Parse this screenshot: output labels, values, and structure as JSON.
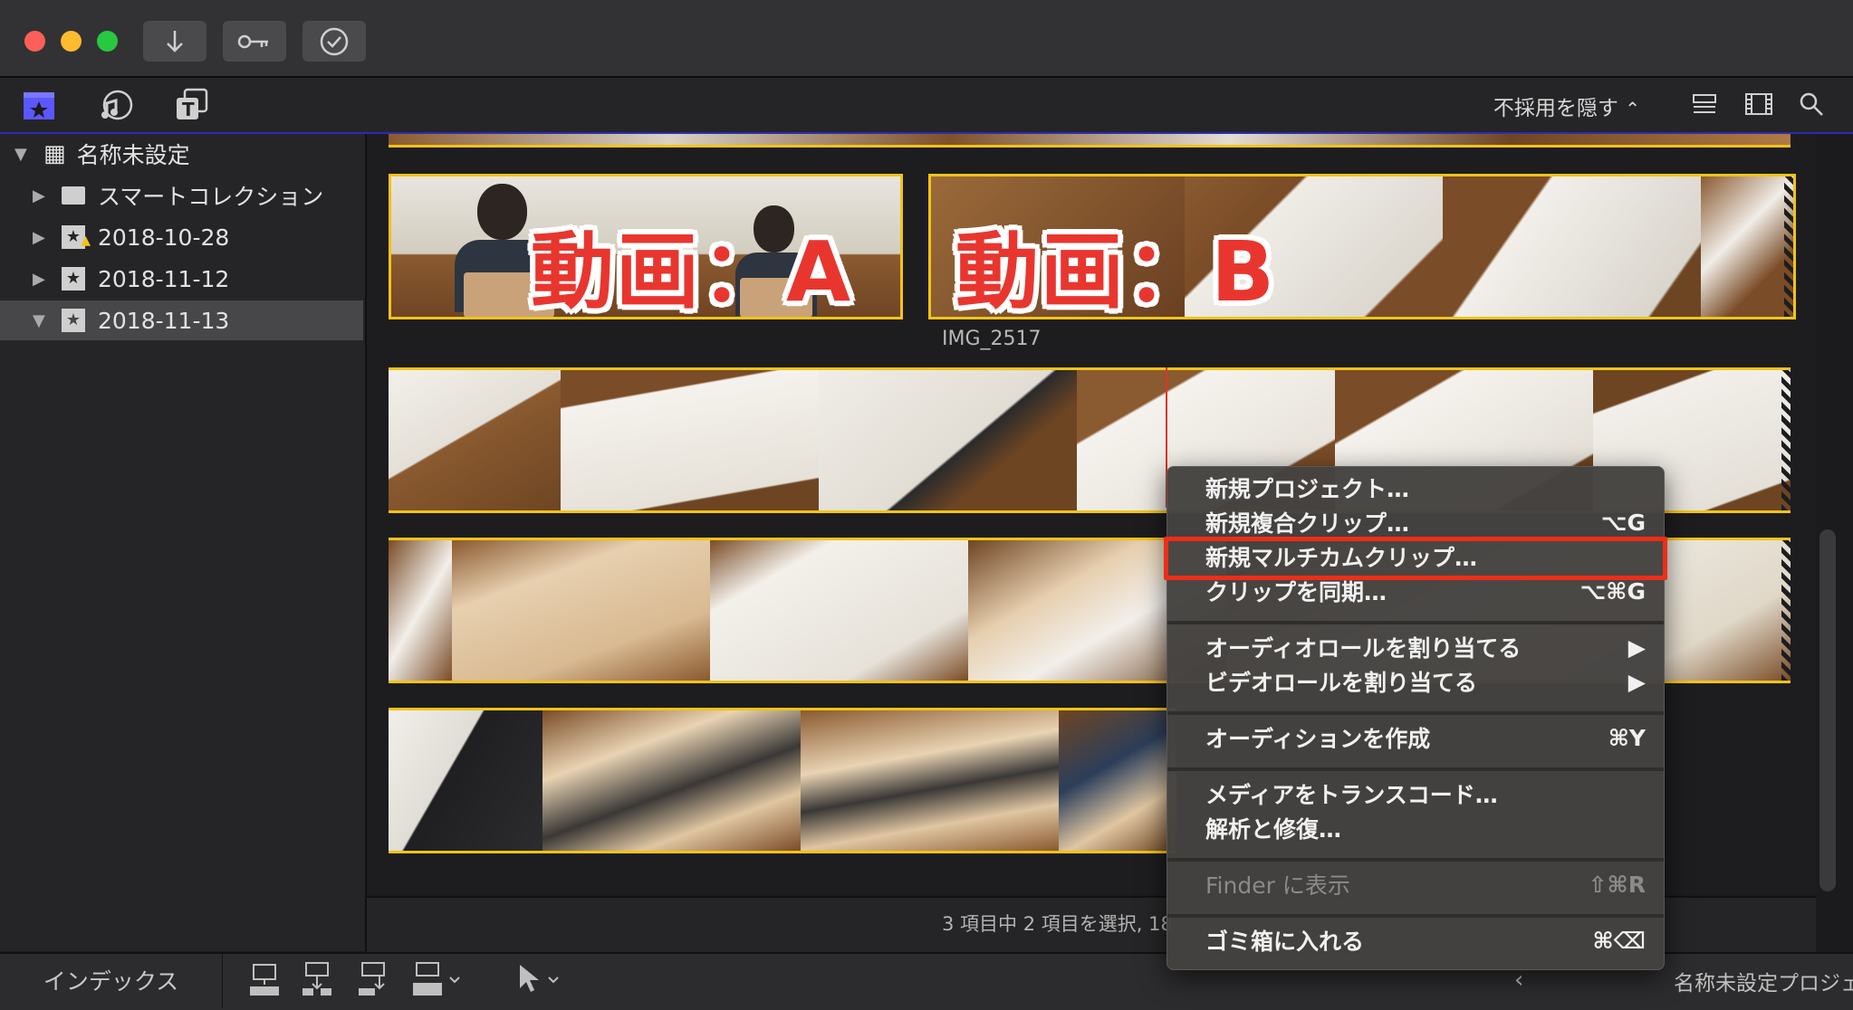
{
  "sidebar": {
    "library": "名称未設定",
    "items": [
      {
        "label": "スマートコレクション"
      },
      {
        "label": "2018-10-28"
      },
      {
        "label": "2018-11-12"
      },
      {
        "label": "2018-11-13"
      }
    ]
  },
  "toolbar": {
    "hide_rejected": "不採用を隠す"
  },
  "clips": {
    "overlay_a": "動画：A",
    "overlay_b": "動画：B",
    "clip_name": "IMG_2517"
  },
  "status": "3 項目中 2 項目を選択, 18",
  "bottom": {
    "index": "インデックス",
    "project": "名称未設定プロジェ"
  },
  "menu": {
    "items": [
      {
        "label": "新規プロジェクト…",
        "shortcut": ""
      },
      {
        "label": "新規複合クリップ…",
        "shortcut": "⌥G"
      },
      {
        "label": "新規マルチカムクリップ…",
        "shortcut": ""
      },
      {
        "label": "クリップを同期…",
        "shortcut": "⌥⌘G"
      },
      {
        "label": "オーディオロールを割り当てる",
        "shortcut": "▶"
      },
      {
        "label": "ビデオロールを割り当てる",
        "shortcut": "▶"
      },
      {
        "label": "オーディションを作成",
        "shortcut": "⌘Y"
      },
      {
        "label": "メディアをトランスコード…",
        "shortcut": ""
      },
      {
        "label": "解析と修復…",
        "shortcut": ""
      },
      {
        "label": "Finder に表示",
        "shortcut": "⇧⌘R"
      },
      {
        "label": "ゴミ箱に入れる",
        "shortcut": "⌘⌫"
      }
    ]
  },
  "colors": {
    "accent_yellow": "#f4c318",
    "highlight_red": "#ee2d18",
    "title_red": "#e8362f"
  }
}
